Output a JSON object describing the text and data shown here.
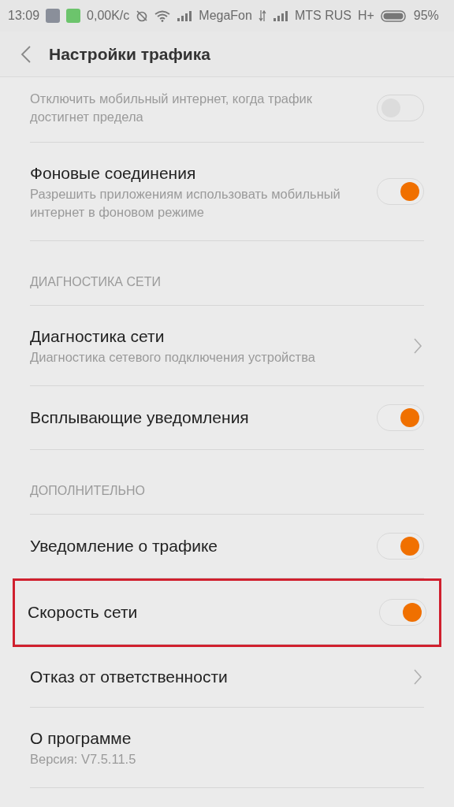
{
  "status_bar": {
    "time": "13:09",
    "speed": "0,00K/c",
    "carrier_1": "MegaFon",
    "carrier_2": "MTS RUS",
    "network_type": "H+",
    "battery": "95%"
  },
  "header": {
    "title": "Настройки трафика"
  },
  "items": [
    {
      "kind": "toggle",
      "subtitle": "Отключить мобильный интернет, когда трафик достигнет предела",
      "on": false,
      "highlighted": false
    },
    {
      "kind": "toggle",
      "title": "Фоновые соединения",
      "subtitle": "Разрешить приложениям использовать мобильный интернет в фоновом режиме",
      "on": true,
      "highlighted": false
    },
    {
      "kind": "section",
      "title": "ДИАГНОСТИКА СЕТИ"
    },
    {
      "kind": "link",
      "title": "Диагностика сети",
      "subtitle": "Диагностика сетевого подключения устройства",
      "highlighted": false
    },
    {
      "kind": "toggle",
      "title": "Всплывающие уведомления",
      "on": true,
      "highlighted": false
    },
    {
      "kind": "section",
      "title": "ДОПОЛНИТЕЛЬНО"
    },
    {
      "kind": "toggle",
      "title": "Уведомление о трафике",
      "on": true,
      "highlighted": false
    },
    {
      "kind": "toggle",
      "title": "Скорость сети",
      "on": true,
      "highlighted": true
    },
    {
      "kind": "link",
      "title": "Отказ от ответственности",
      "highlighted": false
    },
    {
      "kind": "info",
      "title": "О программе",
      "subtitle": "Версия: V7.5.11.5",
      "highlighted": false
    }
  ]
}
